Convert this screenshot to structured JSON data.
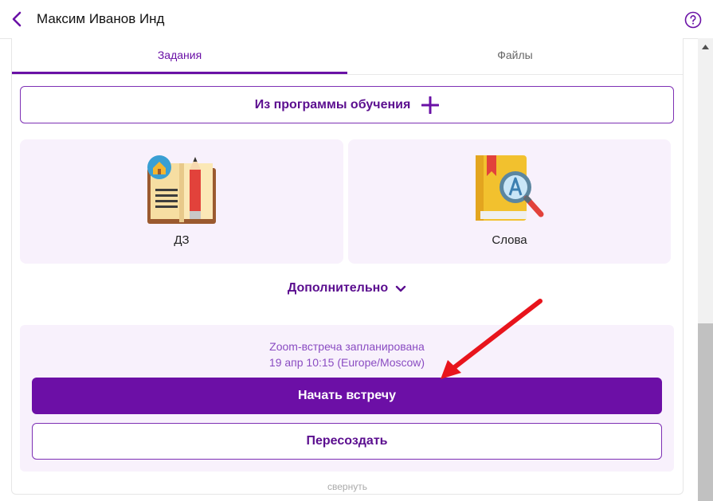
{
  "header": {
    "title": "Максим Иванов Инд",
    "back_icon": "chevron-left-icon",
    "help_icon": "question-circle-icon"
  },
  "tabs": [
    {
      "label": "Задания",
      "active": true
    },
    {
      "label": "Файлы",
      "active": false
    }
  ],
  "program_button": {
    "label": "Из программы обучения",
    "icon": "plus-icon"
  },
  "cards": [
    {
      "label": "ДЗ",
      "icon": "homework-book-icon"
    },
    {
      "label": "Слова",
      "icon": "dictionary-search-icon"
    }
  ],
  "more": {
    "label": "Дополнительно",
    "icon": "chevron-down-icon"
  },
  "zoom": {
    "status_line1": "Zoom-встреча запланирована",
    "status_line2": "19 апр 10:15 (Europe/Moscow)",
    "start_label": "Начать встречу",
    "recreate_label": "Пересоздать"
  },
  "collapse_label": "свернуть",
  "colors": {
    "accent": "#6c0fa6",
    "accent_text": "#5b0e8f",
    "card_bg": "#f8f1fc",
    "annotation_arrow": "#e8141c"
  }
}
